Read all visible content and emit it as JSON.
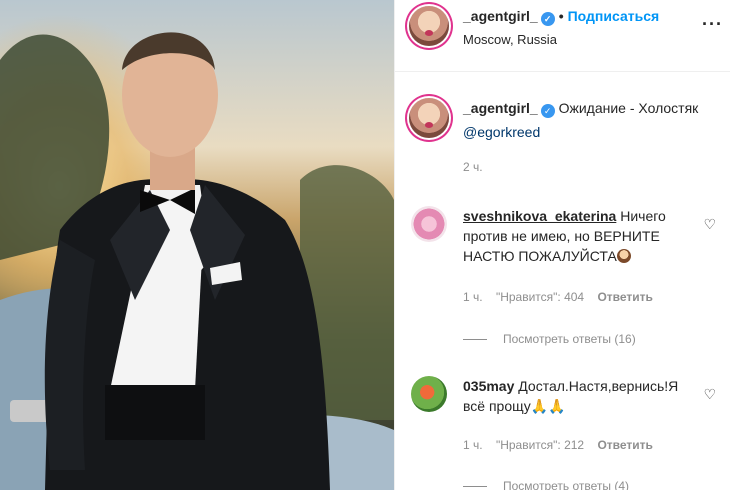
{
  "post": {
    "author": "_agentgirl_",
    "follow_label": "Подписаться",
    "location": "Moscow, Russia",
    "caption_text": "Ожидание - Холостяк",
    "mention": "@egorkreed",
    "time": "2 ч.",
    "more_icon": "more-horizontal-icon"
  },
  "comments": [
    {
      "username": "sveshnikova_ekaterina",
      "text_line1": "Ничего",
      "text_line2": "против не имею, но ВЕРНИТЕ",
      "text_line3": "НАСТЮ ПОЖАЛУЙСТА",
      "emoji": "woman-gesturing-icon",
      "time": "1 ч.",
      "likes": "\"Нравится\": 404",
      "reply_label": "Ответить",
      "view_replies": "Посмотреть ответы (16)"
    },
    {
      "username": "035may",
      "text_line1": "Достал.Настя,вернись!Я",
      "text_line2": "всё прощу",
      "emoji": "folded-hands-icon",
      "time": "1 ч.",
      "likes": "\"Нравится\": 212",
      "reply_label": "Ответить",
      "view_replies": "Посмотреть ответы (4)"
    }
  ],
  "colors": {
    "accent": "#0095f6",
    "verified": "#3897f0",
    "meta": "#8e8e8e"
  }
}
